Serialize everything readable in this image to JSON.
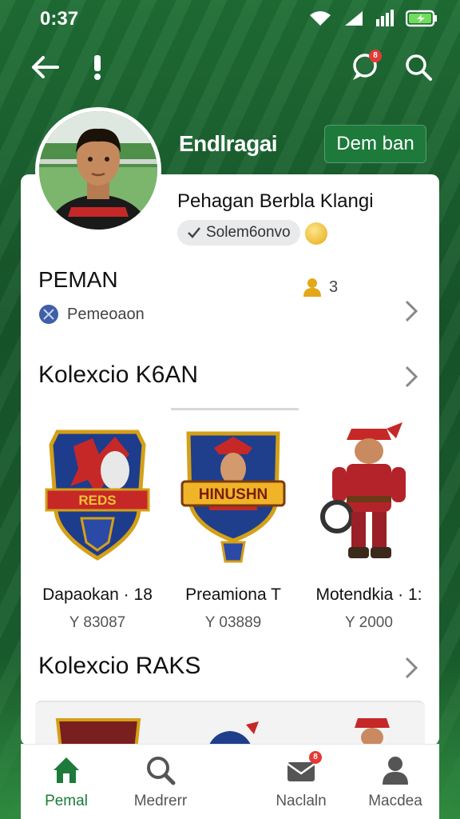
{
  "status_bar": {
    "time": "0:37"
  },
  "header": {
    "back_icon": "arrow-left-icon",
    "alert_icon": "exclamation-icon",
    "chat_badge": "8",
    "search_icon": "search-icon",
    "brand_title": "Endlragai",
    "action_button": "Dem ban"
  },
  "profile": {
    "name": "Pehagan Berbla Klangi",
    "chip_label": "Solem6onvo"
  },
  "pemain_section": {
    "title": "PEMAN",
    "subtitle": "Pemeoaon",
    "count": "3"
  },
  "collection_1": {
    "title": "Kolexcio K6AN",
    "items": [
      {
        "label": "Dapaokan · 18",
        "price": "Y 83087",
        "banner_text": "REDS"
      },
      {
        "label": "Preamiona T",
        "price": "Y 03889",
        "banner_text": "HINUSHN"
      },
      {
        "label": "Motendkia · 1:",
        "price": "Y 2000"
      }
    ]
  },
  "collection_2": {
    "title": "Kolexcio RAKS"
  },
  "bottom_nav": [
    {
      "label": "Pemal",
      "icon": "home-icon",
      "active": true
    },
    {
      "label": "Medrerr",
      "icon": "search-icon",
      "active": false
    },
    {
      "label": "Naclaln",
      "icon": "mail-icon",
      "active": false,
      "badge": "8"
    },
    {
      "label": "Macdea",
      "icon": "profile-icon",
      "active": false
    }
  ],
  "colors": {
    "brand_green": "#1d7a3b",
    "badge_red": "#e53935"
  }
}
